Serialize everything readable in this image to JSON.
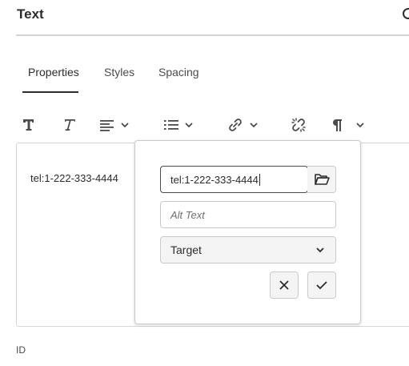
{
  "panel": {
    "title": "Text"
  },
  "tabs": [
    {
      "label": "Properties",
      "active": true
    },
    {
      "label": "Styles",
      "active": false
    },
    {
      "label": "Spacing",
      "active": false
    }
  ],
  "toolbar": {
    "icons": [
      "bold-icon",
      "italic-icon",
      "align-left-icon",
      "chevron-down-icon",
      "list-icon",
      "chevron-down-icon",
      "link-icon",
      "chevron-down-icon",
      "unlink-icon",
      "paragraph-icon",
      "chevron-down-icon"
    ]
  },
  "editor": {
    "content": "tel:1-222-333-4444"
  },
  "link_popover": {
    "url_value": "tel:1-222-333-4444",
    "alt_text_placeholder": "Alt Text",
    "target_value": "Target"
  },
  "fields": {
    "id_label": "ID"
  },
  "colors": {
    "text": "#2c2c2c",
    "border": "#cacaca",
    "divider": "#d5d5d5",
    "button_bg": "#f4f4f4"
  }
}
